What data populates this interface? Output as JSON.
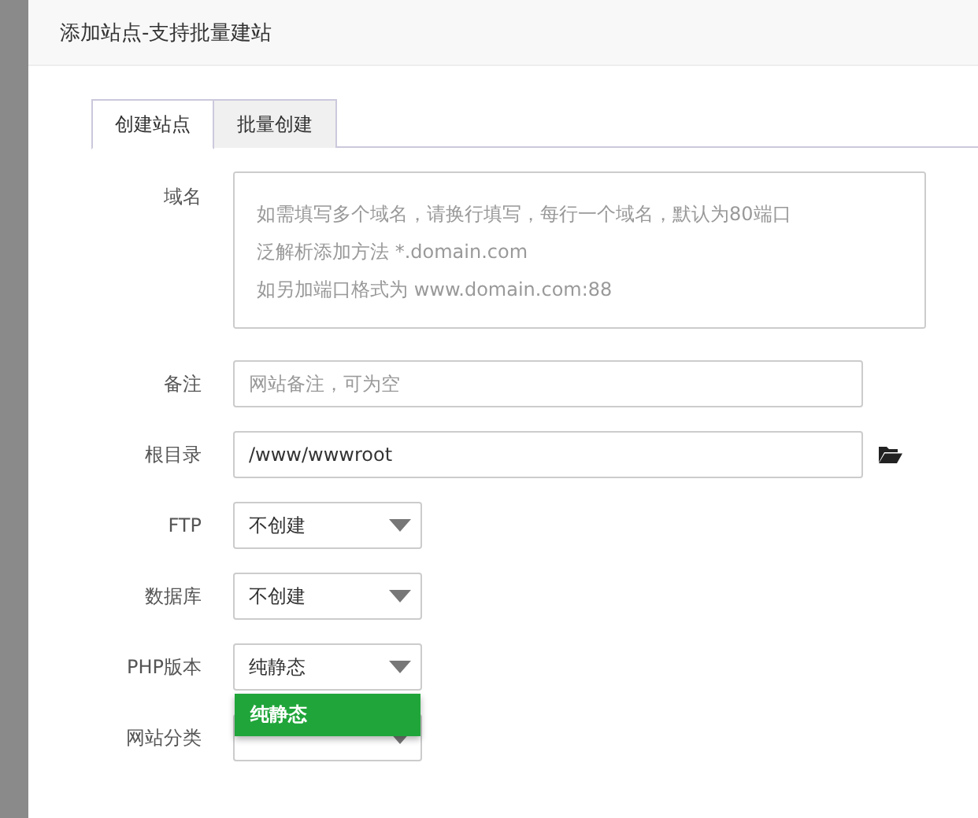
{
  "dialog": {
    "title": "添加站点-支持批量建站"
  },
  "tabs": [
    {
      "label": "创建站点",
      "selected": true
    },
    {
      "label": "批量创建",
      "selected": false
    }
  ],
  "fields": [
    {
      "kind": "textarea",
      "label": "域名",
      "placeholder_lines": [
        "如需填写多个域名，请换行填写，每行一个域名，默认为80端口",
        "泛解析添加方法 *.domain.com",
        "如另加端口格式为 www.domain.com:88"
      ]
    },
    {
      "kind": "input",
      "label": "备注",
      "placeholder": "网站备注，可为空"
    },
    {
      "kind": "path",
      "label": "根目录",
      "value": "/www/wwwroot"
    },
    {
      "kind": "select",
      "label": "FTP",
      "value": "不创建"
    },
    {
      "kind": "select",
      "label": "数据库",
      "value": "不创建"
    },
    {
      "kind": "select",
      "label": "PHP版本",
      "value": "纯静态",
      "open": true,
      "options": [
        {
          "label": "纯静态",
          "selected": true
        }
      ]
    },
    {
      "kind": "select",
      "label": "网站分类"
    }
  ]
}
